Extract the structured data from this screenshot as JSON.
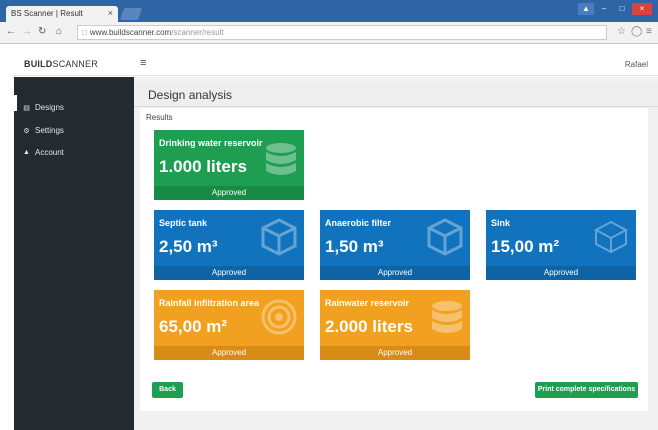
{
  "browser": {
    "tab_title": "BS Scanner | Result",
    "tab_close": "×",
    "window_buttons": [
      "▲",
      "–",
      "□",
      "×"
    ],
    "url_domain": "www.buildscanner.com",
    "url_path": "/scanner/result"
  },
  "header": {
    "brand_bold": "BUILD",
    "brand_rest": "SCANNER",
    "menu_icon": "≡",
    "user": "Rafael"
  },
  "sidebar": {
    "items": [
      {
        "label": "Designs",
        "icon": "▤"
      },
      {
        "label": "Settings",
        "icon": "⚙"
      },
      {
        "label": "Account",
        "icon": "▲"
      }
    ]
  },
  "main": {
    "title": "Design analysis",
    "section": "Results",
    "cards": [
      {
        "title": "Drinking water reservoir",
        "value": "1.000 liters",
        "status": "Approved",
        "color": "#1e9e50",
        "icon": "database-icon"
      },
      {
        "title": "Septic tank",
        "value": "2,50 m³",
        "status": "Approved",
        "color": "#1173bd",
        "icon": "cube-icon"
      },
      {
        "title": "Anaerobic filter",
        "value": "1,50 m³",
        "status": "Approved",
        "color": "#1173bd",
        "icon": "cube-icon"
      },
      {
        "title": "Sink",
        "value": "15,00 m²",
        "status": "Approved",
        "color": "#1173bd",
        "icon": "square-outline-icon"
      },
      {
        "title": "Rainfall infiltration area",
        "value": "65,00 m²",
        "status": "Approved",
        "color": "#f2a01f",
        "icon": "target-icon"
      },
      {
        "title": "Rainwater reservoir",
        "value": "2.000 liters",
        "status": "Approved",
        "color": "#f2a01f",
        "icon": "database-icon"
      }
    ],
    "back_button": "Back",
    "print_button": "Print complete specifications"
  }
}
